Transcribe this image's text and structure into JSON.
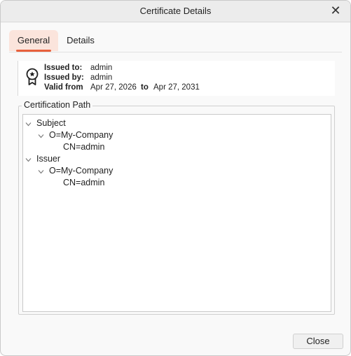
{
  "window": {
    "title": "Certificate Details",
    "close_glyph": "✕"
  },
  "tabs": [
    {
      "label": "General"
    },
    {
      "label": "Details"
    }
  ],
  "summary": {
    "issued_to_label": "Issued to:",
    "issued_to_value": "admin",
    "issued_by_label": "Issued by:",
    "issued_by_value": "admin",
    "valid_from_label": "Valid from",
    "valid_from_value": "Apr 27, 2026",
    "to_label": "to",
    "valid_to_value": "Apr 27, 2031",
    "icon": "certificate-badge-icon"
  },
  "certification_path": {
    "legend": "Certification Path",
    "nodes": [
      {
        "label": "Subject"
      },
      {
        "label": "O=My-Company"
      },
      {
        "label": "CN=admin"
      },
      {
        "label": "Issuer"
      },
      {
        "label": "O=My-Company"
      },
      {
        "label": "CN=admin"
      }
    ]
  },
  "footer": {
    "close_label": "Close"
  },
  "colors": {
    "accent": "#e8603c",
    "tab_active_bg": "#fbe4dc"
  }
}
